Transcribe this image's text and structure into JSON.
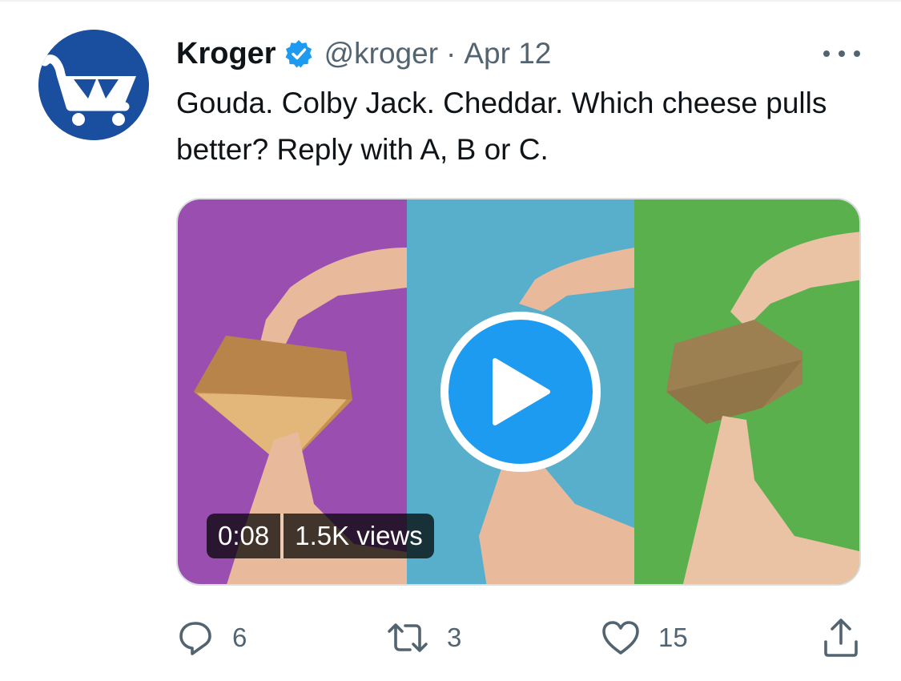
{
  "tweet": {
    "author_name": "Kroger",
    "verified": true,
    "handle": "@kroger",
    "separator": "·",
    "date": "Apr 12",
    "text": "Gouda. Colby Jack. Cheddar. Which cheese pulls better? Reply with A, B or C.",
    "more_icon": "more-horizontal-icon",
    "avatar_icon": "kroger-cart-logo",
    "brand_color": "#1a4fa0",
    "accent_color": "#1d9bf0"
  },
  "media": {
    "type": "video",
    "duration": "0:08",
    "views": "1.5K views",
    "play_icon": "play-icon",
    "panel_colors": [
      "#9a4fb0",
      "#58afcc",
      "#5bb04e"
    ]
  },
  "actions": {
    "reply": {
      "icon": "reply-icon",
      "count": "6"
    },
    "retweet": {
      "icon": "retweet-icon",
      "count": "3"
    },
    "like": {
      "icon": "heart-icon",
      "count": "15"
    },
    "share": {
      "icon": "share-icon"
    }
  }
}
